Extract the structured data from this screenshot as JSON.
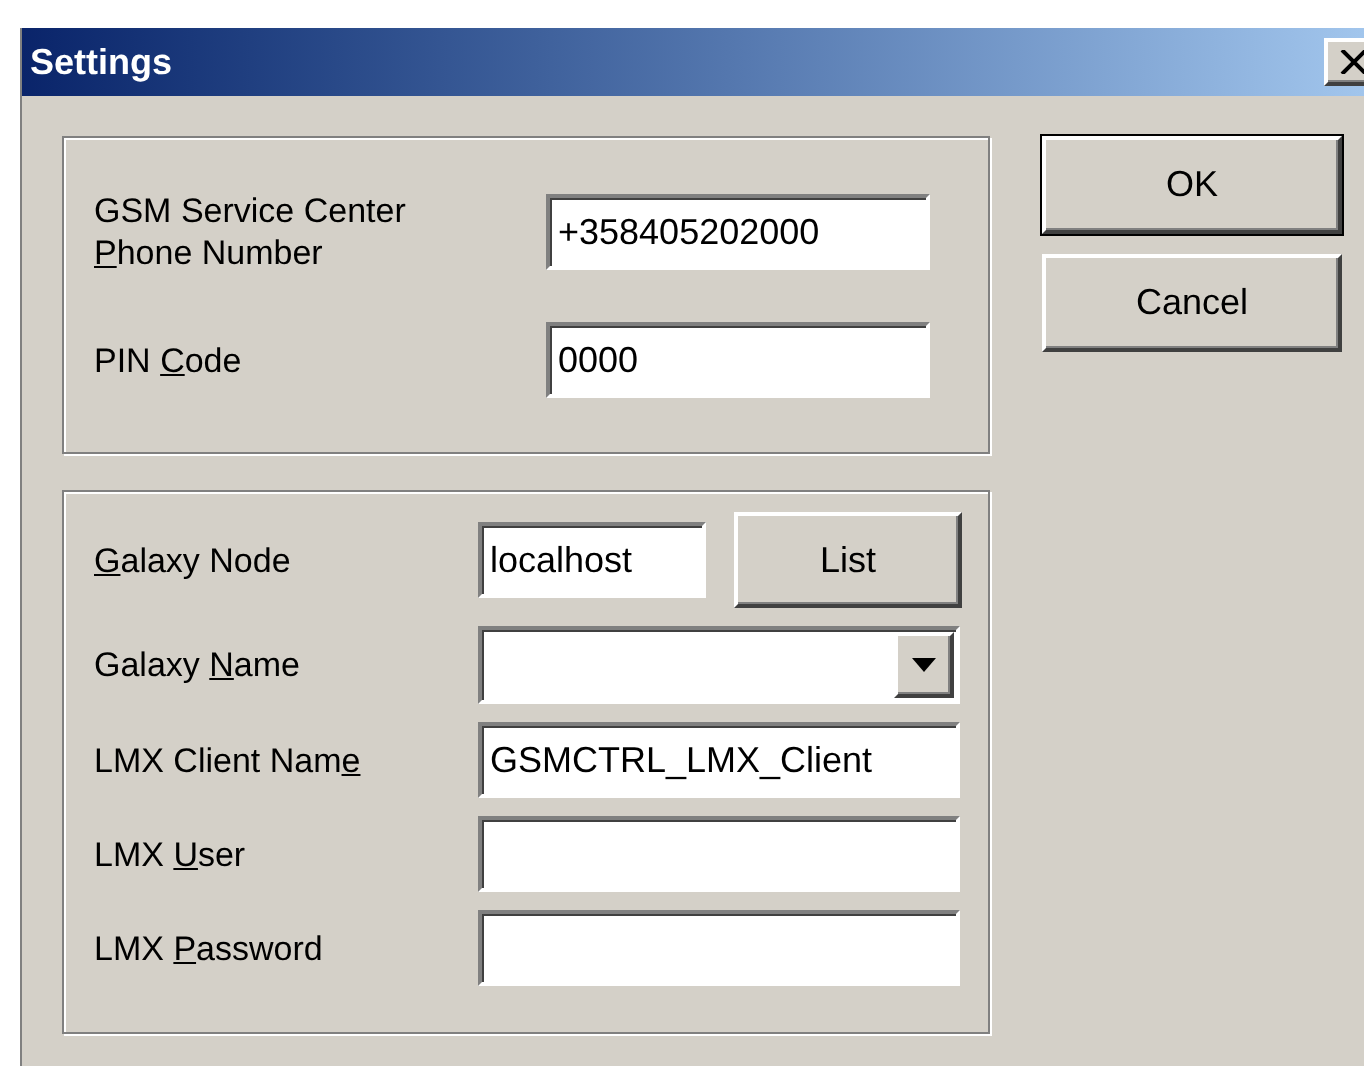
{
  "window": {
    "title": "Settings"
  },
  "groups": [
    {
      "fields": [
        {
          "kind": "text",
          "label": [
            {
              "text": "GSM Service Center ",
              "underlined": false
            },
            {
              "text": "P",
              "underlined": true
            },
            {
              "text": "hone Number",
              "underlined": false
            }
          ],
          "value": "+358405202000"
        },
        {
          "kind": "text",
          "label": [
            {
              "text": "PIN ",
              "underlined": false
            },
            {
              "text": "C",
              "underlined": true
            },
            {
              "text": "ode",
              "underlined": false
            }
          ],
          "value": "0000"
        }
      ]
    },
    {
      "fields": [
        {
          "kind": "text_with_button",
          "label": [
            {
              "text": "G",
              "underlined": true
            },
            {
              "text": "alaxy Node",
              "underlined": false
            }
          ],
          "value": "localhost",
          "button": "List"
        },
        {
          "kind": "combo",
          "label": [
            {
              "text": "Galaxy ",
              "underlined": false
            },
            {
              "text": "N",
              "underlined": true
            },
            {
              "text": "ame",
              "underlined": false
            }
          ]
        },
        {
          "kind": "text",
          "label": [
            {
              "text": "LMX Client Nam",
              "underlined": false
            },
            {
              "text": "e",
              "underlined": true
            }
          ],
          "value": "GSMCTRL_LMX_Client"
        },
        {
          "kind": "text",
          "label": [
            {
              "text": "LMX ",
              "underlined": false
            },
            {
              "text": "U",
              "underlined": true
            },
            {
              "text": "ser",
              "underlined": false
            }
          ]
        },
        {
          "kind": "text",
          "label": [
            {
              "text": "LMX ",
              "underlined": false
            },
            {
              "text": "P",
              "underlined": true
            },
            {
              "text": "assword",
              "underlined": false
            }
          ]
        }
      ]
    }
  ],
  "buttons": [
    {
      "label": "OK",
      "default": true
    },
    {
      "label": "Cancel",
      "default": false
    }
  ]
}
